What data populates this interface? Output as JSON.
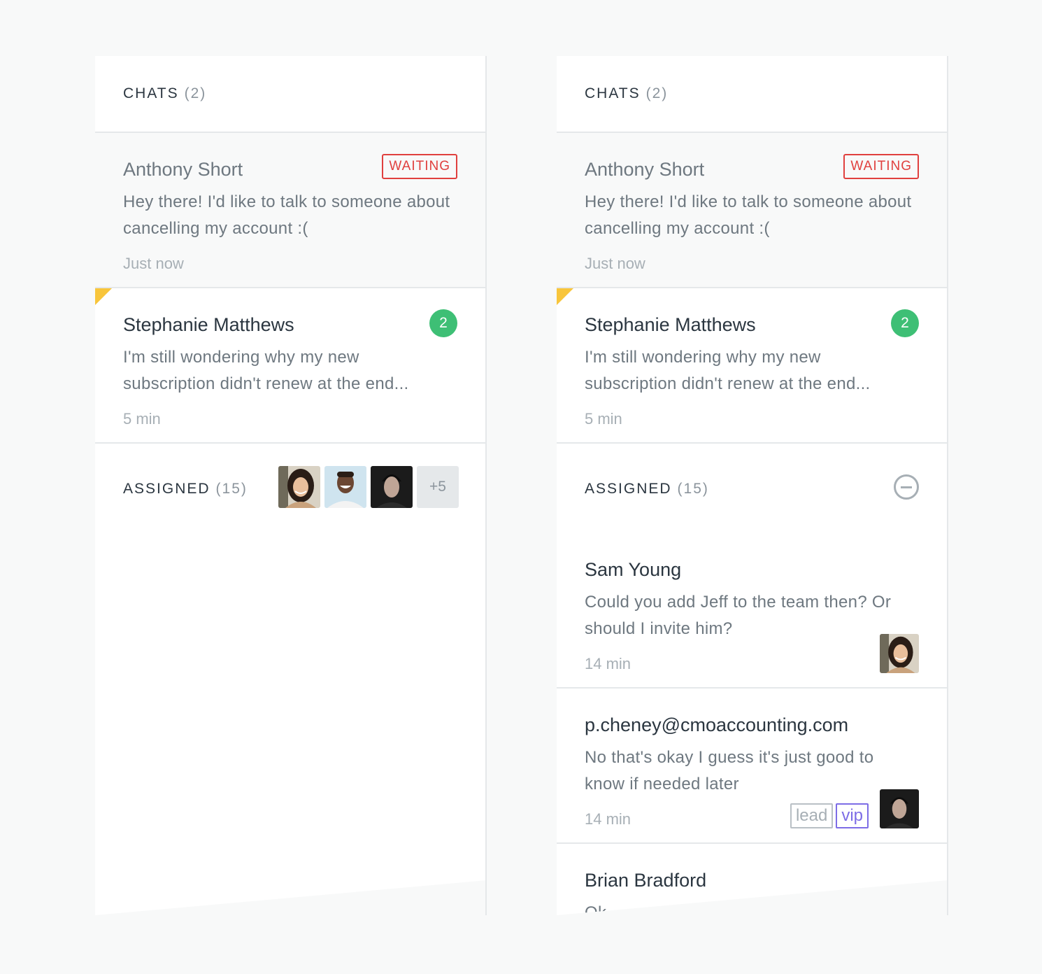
{
  "colors": {
    "background": "#f8f9f9",
    "waiting_red": "#e0403e",
    "unread_green": "#3ebf75",
    "flag_yellow": "#f8c53b",
    "vip_purple": "#7d6de6"
  },
  "left": {
    "chats": {
      "title": "CHATS",
      "count": "(2)",
      "items": [
        {
          "name": "Anthony Short",
          "message": "Hey there! I'd like to talk to someone about cancelling my account :(",
          "time": "Just now",
          "badge": "WAITING"
        },
        {
          "name": "Stephanie Matthews",
          "message": "I'm still wondering why my new subscription didn't renew at the end...",
          "time": "5 min",
          "badge": "2"
        }
      ]
    },
    "assigned": {
      "title": "ASSIGNED",
      "count": "(15)",
      "more": "+5",
      "avatars": [
        "avatar-asian-woman",
        "avatar-smiling-man",
        "avatar-dark-hair-man"
      ]
    }
  },
  "right": {
    "chats": {
      "title": "CHATS",
      "count": "(2)",
      "items": [
        {
          "name": "Anthony Short",
          "message": "Hey there! I'd like to talk to someone about cancelling my account :(",
          "time": "Just now",
          "badge": "WAITING"
        },
        {
          "name": "Stephanie Matthews",
          "message": "I'm still wondering why my new subscription didn't renew at the end...",
          "time": "5 min",
          "badge": "2"
        }
      ]
    },
    "assigned": {
      "title": "ASSIGNED",
      "count": "(15)",
      "items": [
        {
          "name": "Sam Young",
          "message": "Could you add Jeff to the team then? Or should I invite him?",
          "time": "14 min"
        },
        {
          "name": "p.cheney@cmoaccounting.com",
          "message": "No that's okay I guess it's just good to know if needed later",
          "time": "14 min",
          "tags": [
            "lead",
            "vip"
          ]
        },
        {
          "name": "Brian Bradford",
          "message": "Ok"
        }
      ]
    }
  }
}
